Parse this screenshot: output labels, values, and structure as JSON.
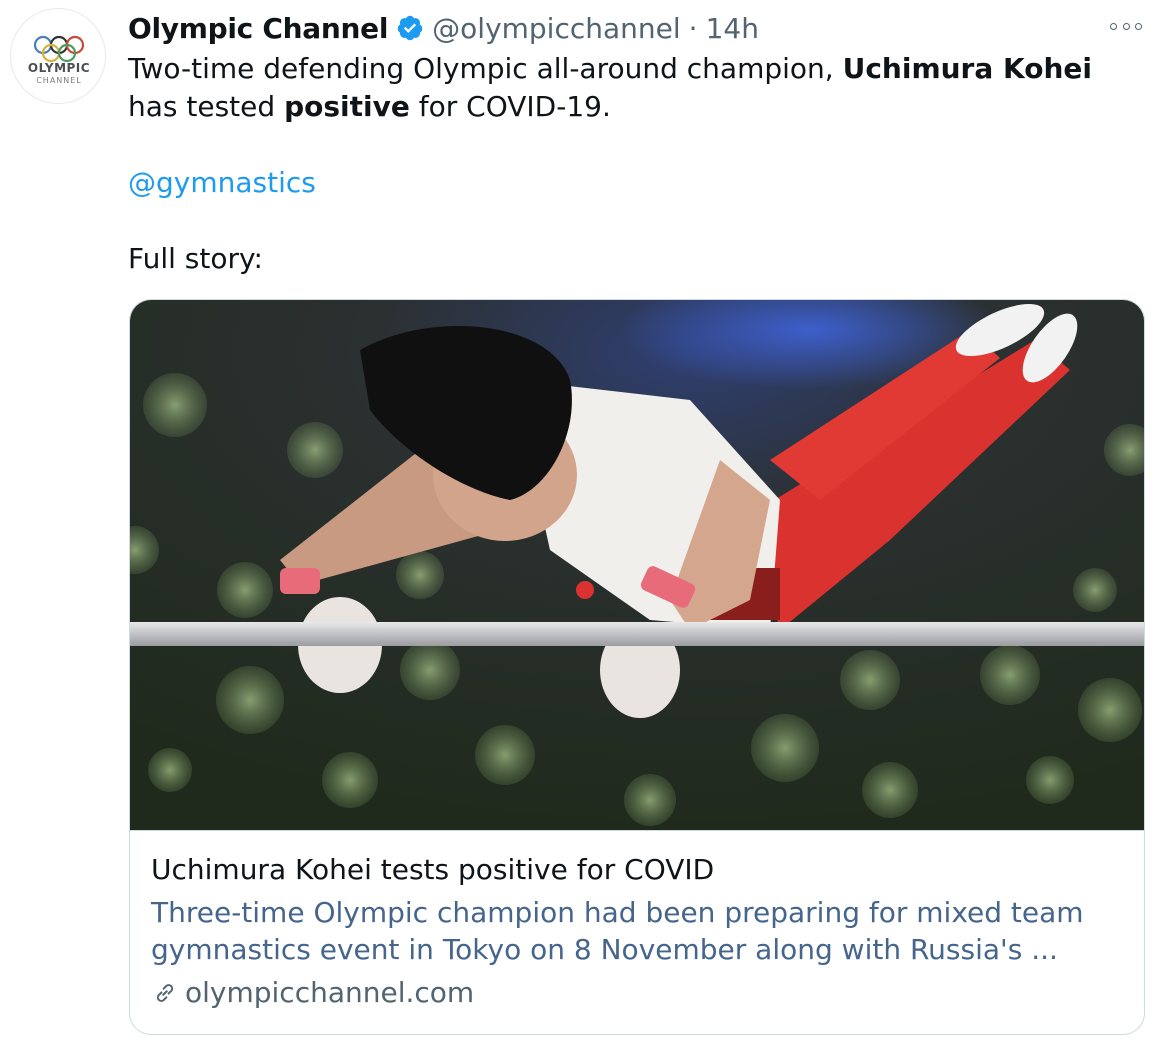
{
  "author": {
    "avatar_brand_line1": "OLYMPIC",
    "avatar_brand_line2": "CHANNEL",
    "display_name": "Olympic Channel",
    "handle": "@olympicchannel",
    "separator": "·",
    "timestamp": "14h",
    "verified": true
  },
  "tweet": {
    "text_part1": "Two-time defending Olympic all-around champion, ",
    "text_bold1": "Uchimura Kohei",
    "text_part2": " has tested ",
    "text_bold2": "positive",
    "text_part3": " for COVID-19.",
    "mention": "@gymnastics",
    "full_story": "Full story:"
  },
  "card": {
    "image_alt_icon": "gymnast-photo",
    "title": "Uchimura Kohei tests positive for COVID",
    "description": "Three-time Olympic champion had been preparing for mixed team gymnastics event in Tokyo on 8 November along with Russia's ...",
    "domain": "olympicchannel.com"
  },
  "icons": {
    "verified": "verified-badge-icon",
    "more": "more-options-icon",
    "link": "link-icon"
  },
  "colors": {
    "link_blue": "#1d9bf0",
    "secondary_text": "#536471",
    "border": "#cfd9de"
  }
}
